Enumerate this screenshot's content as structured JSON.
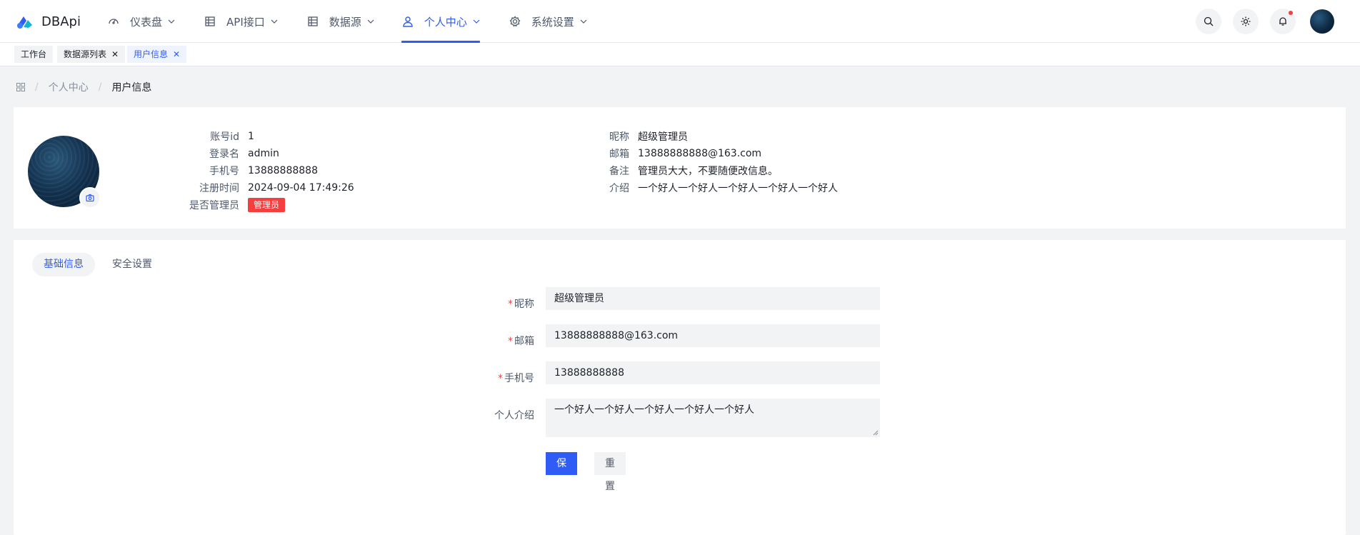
{
  "app": {
    "name": "DBApi"
  },
  "nav": [
    {
      "label": "仪表盘",
      "icon": "dashboard-icon"
    },
    {
      "label": "API接口",
      "icon": "api-icon"
    },
    {
      "label": "数据源",
      "icon": "datasource-icon"
    },
    {
      "label": "个人中心",
      "icon": "user-icon",
      "active": true
    },
    {
      "label": "系统设置",
      "icon": "settings-icon"
    }
  ],
  "tabs_open": [
    {
      "label": "工作台",
      "closable": false
    },
    {
      "label": "数据源列表",
      "closable": true
    },
    {
      "label": "用户信息",
      "closable": true,
      "active": true
    }
  ],
  "breadcrumb": {
    "level1": "个人中心",
    "current": "用户信息"
  },
  "profile": {
    "account_id_label": "账号id",
    "account_id": "1",
    "login_label": "登录名",
    "login": "admin",
    "phone_label": "手机号",
    "phone": "13888888888",
    "reg_label": "注册时间",
    "reg_time": "2024-09-04 17:49:26",
    "admin_label": "是否管理员",
    "admin_badge": "管理员",
    "nickname_label": "昵称",
    "nickname": "超级管理员",
    "email_label": "邮箱",
    "email": "13888888888@163.com",
    "remark_label": "备注",
    "remark": "管理员大大，不要随便改信息。",
    "intro_label": "介绍",
    "intro": "一个好人一个好人一个好人一个好人一个好人"
  },
  "form_tabs": {
    "basic": "基础信息",
    "security": "安全设置"
  },
  "form": {
    "nickname_label": "昵称",
    "nickname_value": "超级管理员",
    "email_label": "邮箱",
    "email_value": "13888888888@163.com",
    "phone_label": "手机号",
    "phone_value": "13888888888",
    "intro_label": "个人介绍",
    "intro_value": "一个好人一个好人一个好人一个好人一个好人",
    "save": "保存",
    "reset": "重置"
  },
  "colors": {
    "primary": "#2f5cf5",
    "danger": "#f53f3f",
    "bg": "#f2f3f5"
  }
}
